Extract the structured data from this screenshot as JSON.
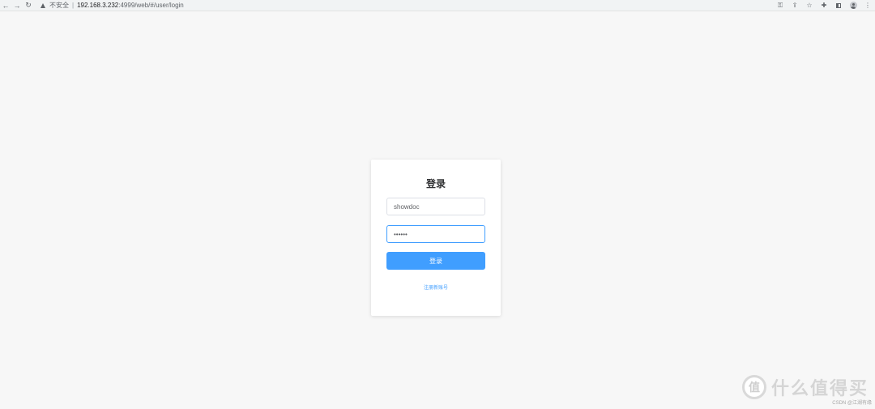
{
  "browser": {
    "back_icon": "arrow-left-icon",
    "forward_icon": "arrow-right-icon",
    "reload_icon": "reload-icon",
    "security_label": "不安全",
    "separator": "|",
    "url_host": "192.168.3.232",
    "url_rest": ":4999/web/#/user/login",
    "right_icons": [
      "key-icon",
      "share-icon",
      "star-icon",
      "extensions-icon",
      "side-panel-icon",
      "profile-icon",
      "menu-icon"
    ]
  },
  "login": {
    "title": "登录",
    "username_value": "showdoc",
    "password_value": "••••••",
    "submit_label": "登录",
    "register_label": "注册新账号"
  },
  "colors": {
    "primary": "#409eff",
    "background": "#f7f7f7"
  },
  "watermark": {
    "logo_text": "值",
    "text": "什么值得买"
  },
  "credit": "CSDN @江湖有缘"
}
